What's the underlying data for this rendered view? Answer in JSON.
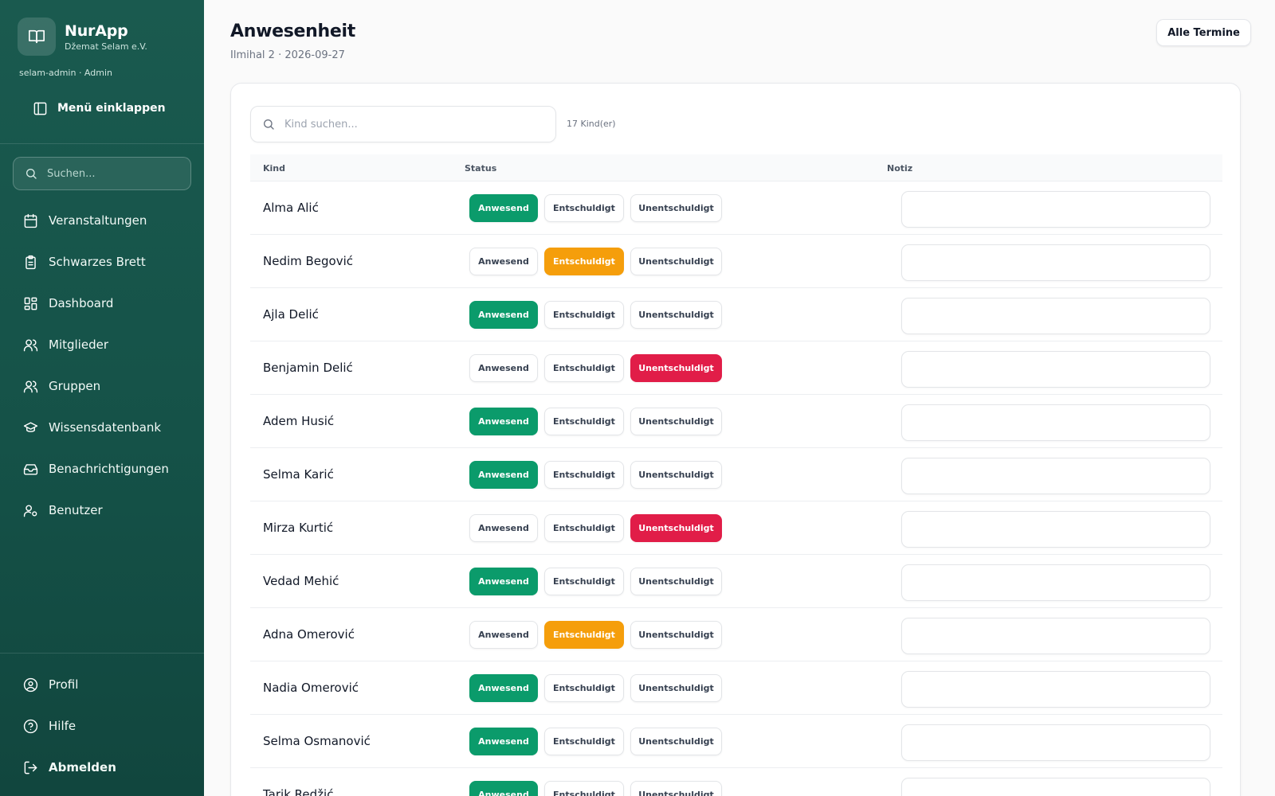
{
  "brand": {
    "name": "NurApp",
    "org": "Džemat Selam e.V.",
    "icon": "book-open-icon"
  },
  "user_line": "selam-admin · Admin",
  "collapse_label": "Menü einklappen",
  "sidebar_search": {
    "placeholder": "Suchen..."
  },
  "nav": [
    {
      "label": "Veranstaltungen",
      "icon": "calendar-icon"
    },
    {
      "label": "Schwarzes Brett",
      "icon": "clipboard-icon"
    },
    {
      "label": "Dashboard",
      "icon": "dashboard-grid-icon"
    },
    {
      "label": "Mitglieder",
      "icon": "users-icon"
    },
    {
      "label": "Gruppen",
      "icon": "users-icon"
    },
    {
      "label": "Wissensdatenbank",
      "icon": "graduation-cap-icon"
    },
    {
      "label": "Benachrichtigungen",
      "icon": "inbox-icon"
    },
    {
      "label": "Benutzer",
      "icon": "user-cog-icon"
    }
  ],
  "footer_nav": [
    {
      "label": "Profil",
      "icon": "user-circle-icon"
    },
    {
      "label": "Hilfe",
      "icon": "help-circle-icon"
    },
    {
      "label": "Abmelden",
      "icon": "logout-icon"
    }
  ],
  "page": {
    "title": "Anwesenheit",
    "subtitle": "Ilmihal 2 · 2026-09-27",
    "all_button": "Alle Termine"
  },
  "search": {
    "placeholder": "Kind suchen...",
    "count": "17 Kind(er)"
  },
  "table": {
    "headers": {
      "kind": "Kind",
      "status": "Status",
      "notiz": "Notiz"
    },
    "status_labels": {
      "present": "Anwesend",
      "excused": "Entschuldigt",
      "unexcused": "Unentschuldigt"
    },
    "rows": [
      {
        "name": "Alma Alić",
        "status": "present",
        "note": ""
      },
      {
        "name": "Nedim Begović",
        "status": "excused",
        "note": ""
      },
      {
        "name": "Ajla Delić",
        "status": "present",
        "note": ""
      },
      {
        "name": "Benjamin Delić",
        "status": "unexcused",
        "note": ""
      },
      {
        "name": "Adem Husić",
        "status": "present",
        "note": ""
      },
      {
        "name": "Selma Karić",
        "status": "present",
        "note": ""
      },
      {
        "name": "Mirza Kurtić",
        "status": "unexcused",
        "note": ""
      },
      {
        "name": "Vedad Mehić",
        "status": "present",
        "note": ""
      },
      {
        "name": "Adna Omerović",
        "status": "excused",
        "note": ""
      },
      {
        "name": "Nadia Omerović",
        "status": "present",
        "note": ""
      },
      {
        "name": "Selma Osmanović",
        "status": "present",
        "note": ""
      },
      {
        "name": "Tarik Redžić",
        "status": "present",
        "note": ""
      }
    ]
  },
  "colors": {
    "sidebar": "#155248",
    "present": "#0b9b6b",
    "excused": "#f59e0b",
    "unexcused": "#e11d48"
  }
}
